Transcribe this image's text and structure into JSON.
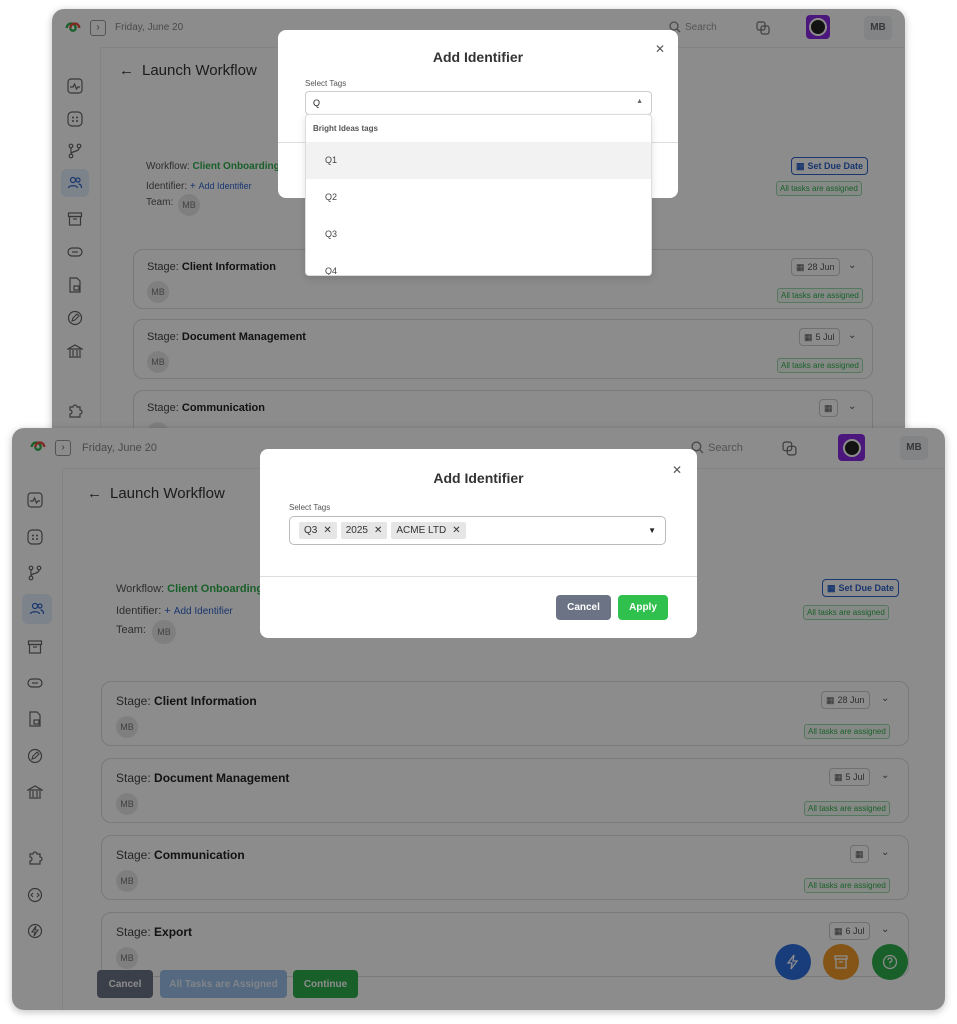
{
  "header": {
    "date": "Friday, June 20",
    "search_placeholder": "Search",
    "user_initials": "MB"
  },
  "page": {
    "title": "Launch Workflow"
  },
  "workflow": {
    "workflow_label": "Workflow:",
    "workflow_name": "Client Onboarding",
    "identifier_label": "Identifier:",
    "add_identifier": "Add Identifier",
    "team_label": "Team:",
    "team_member": "MB",
    "set_due_date": "Set Due Date",
    "all_assigned": "All tasks are assigned"
  },
  "stages": [
    {
      "prefix": "Stage:",
      "name": "Client Information",
      "date": "28 Jun",
      "assignee": "MB",
      "status": "All tasks are assigned"
    },
    {
      "prefix": "Stage:",
      "name": "Document Management",
      "date": "5 Jul",
      "assignee": "MB",
      "status": "All tasks are assigned"
    },
    {
      "prefix": "Stage:",
      "name": "Communication",
      "date": "",
      "assignee": "MB",
      "status": "All tasks are assigned"
    },
    {
      "prefix": "Stage:",
      "name": "Export",
      "date": "6 Jul",
      "assignee": "MB",
      "status": ""
    }
  ],
  "modal_top": {
    "title": "Add Identifier",
    "select_label": "Select Tags",
    "search_value": "Q",
    "group_label": "Bright Ideas tags",
    "options": [
      "Q1",
      "Q2",
      "Q3",
      "Q4"
    ]
  },
  "modal_bottom": {
    "title": "Add Identifier",
    "select_label": "Select Tags",
    "selected_tags": [
      "Q3",
      "2025",
      "ACME LTD"
    ],
    "cancel": "Cancel",
    "apply": "Apply"
  },
  "footer": {
    "cancel": "Cancel",
    "assigned": "All Tasks are Assigned",
    "continue": "Continue"
  },
  "colors": {
    "green": "#2fae4b",
    "blue_link": "#2f63c9",
    "fab_blue": "#2f6fe0",
    "fab_orange": "#f39c2b",
    "fab_green": "#2fae4b",
    "cancel_gray": "#6c7385"
  }
}
